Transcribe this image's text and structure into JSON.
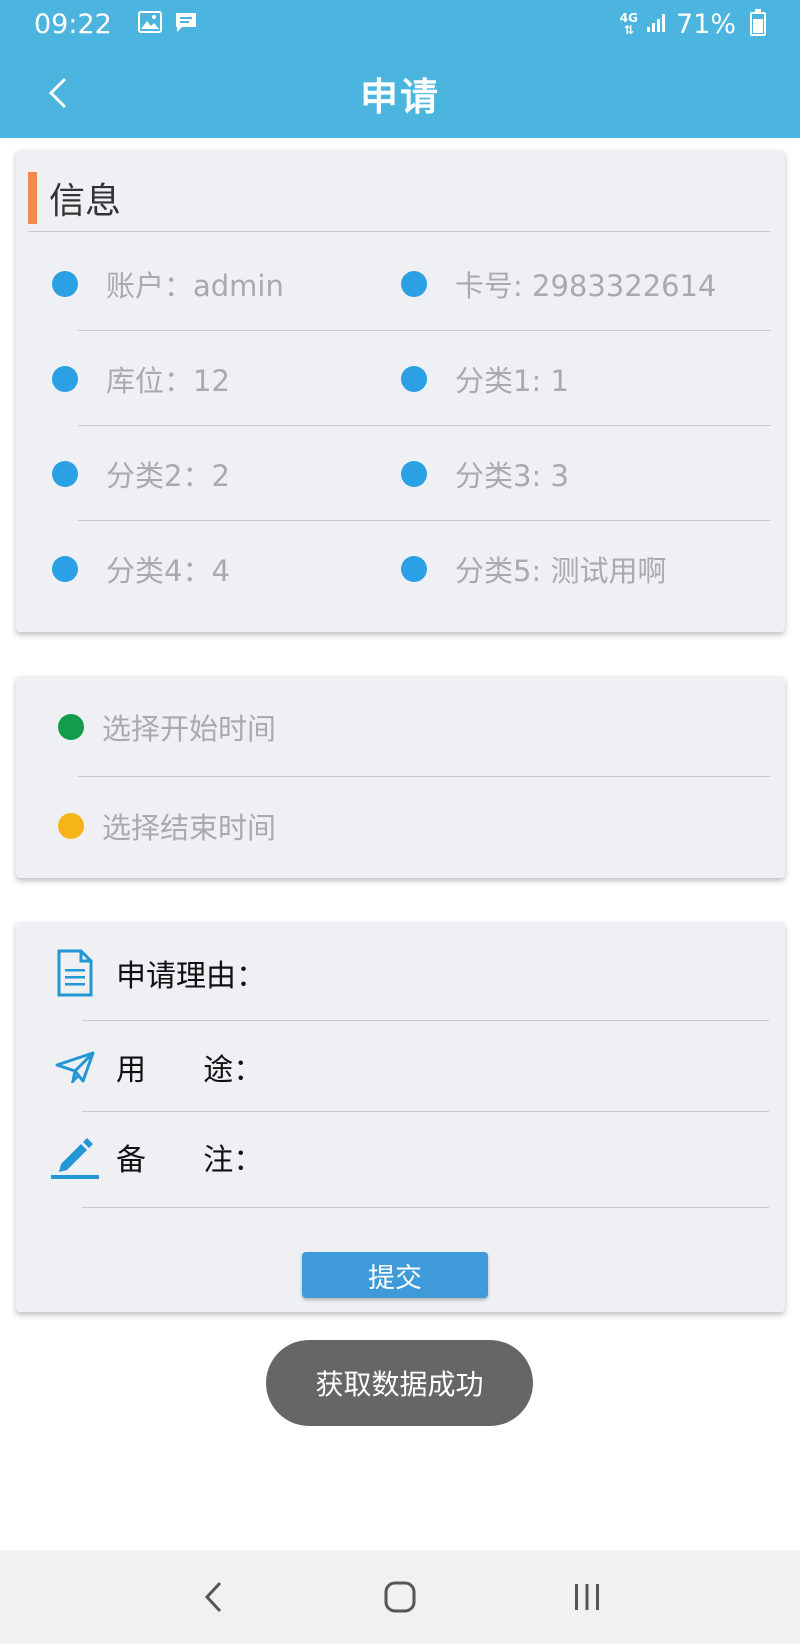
{
  "status_bar": {
    "time": "09:22",
    "network": "4G",
    "battery": "71%",
    "battery_level": 0.71
  },
  "app_bar": {
    "title": "申请"
  },
  "info": {
    "title": "信息",
    "accent_color": "#f08a4b",
    "dot_color": "#2ba0e4",
    "items": [
      {
        "left": "账户：admin",
        "right": "卡号: 2983322614"
      },
      {
        "left": "库位：12",
        "right": "分类1: 1"
      },
      {
        "left": "分类2：2",
        "right": "分类3: 3"
      },
      {
        "left": "分类4：4",
        "right": "分类5: 测试用啊"
      }
    ]
  },
  "time_select": {
    "start": {
      "label": "选择开始时间",
      "dot_color": "#139c4a"
    },
    "end": {
      "label": "选择结束时间",
      "dot_color": "#f6b419"
    }
  },
  "form": {
    "reason": {
      "label": "申请理由：",
      "icon": "document-icon",
      "value": ""
    },
    "purpose": {
      "label": "用      途：",
      "icon": "paper-plane-icon",
      "value": ""
    },
    "remark": {
      "label": "备      注：",
      "icon": "pencil-icon",
      "value": ""
    },
    "submit_label": "提交"
  },
  "toast": {
    "message": "获取数据成功"
  },
  "colors": {
    "primary": "#4bb4df",
    "button": "#3f9ad9",
    "card_bg": "#eef0f4",
    "icon_blue": "#2396d6"
  }
}
